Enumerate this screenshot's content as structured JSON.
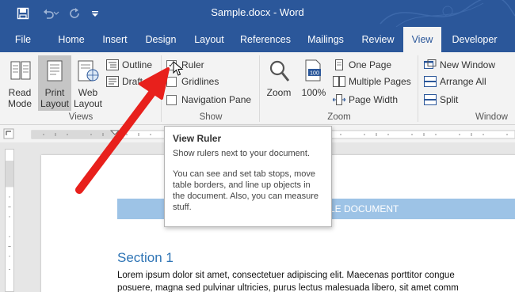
{
  "window": {
    "title": "Sample.docx - Word"
  },
  "tabs": [
    {
      "label": "File"
    },
    {
      "label": "Home"
    },
    {
      "label": "Insert"
    },
    {
      "label": "Design"
    },
    {
      "label": "Layout"
    },
    {
      "label": "References"
    },
    {
      "label": "Mailings"
    },
    {
      "label": "Review"
    },
    {
      "label": "View",
      "active": true
    },
    {
      "label": "Developer"
    }
  ],
  "ribbon": {
    "views": {
      "read_mode_line1": "Read",
      "read_mode_line2": "Mode",
      "print_layout_line1": "Print",
      "print_layout_line2": "Layout",
      "web_layout_line1": "Web",
      "web_layout_line2": "Layout",
      "outline": "Outline",
      "draft": "Draft",
      "group_label": "Views"
    },
    "show": {
      "ruler": "Ruler",
      "ruler_checked": true,
      "gridlines": "Gridlines",
      "gridlines_checked": false,
      "navigation_pane": "Navigation Pane",
      "navigation_pane_checked": false,
      "group_label": "Show"
    },
    "zoom": {
      "zoom": "Zoom",
      "hundred_percent": "100%",
      "one_page": "One Page",
      "multiple_pages": "Multiple Pages",
      "page_width": "Page Width",
      "group_label": "Zoom"
    },
    "window": {
      "new_window": "New Window",
      "arrange_all": "Arrange All",
      "split": "Split",
      "group_label": "Window"
    }
  },
  "tooltip": {
    "title": "View Ruler",
    "line1": "Show rulers next to your document.",
    "line2": "You can see and set tab stops, move table borders, and line up objects in the document. Also, you can measure stuff."
  },
  "document": {
    "banner_text": "SAMPLE DOCUMENT",
    "section_heading": "Section 1",
    "paragraph_line1": "Lorem ipsum dolor sit amet, consectetuer adipiscing elit. Maecenas porttitor congue",
    "paragraph_line2": "posuere, magna sed pulvinar ultricies, purus lectus malesuada libero, sit amet comm"
  },
  "colors": {
    "accent": "#2b579a",
    "arrow": "#e8201c",
    "banner": "#9dc3e6",
    "heading": "#2e74b5"
  }
}
